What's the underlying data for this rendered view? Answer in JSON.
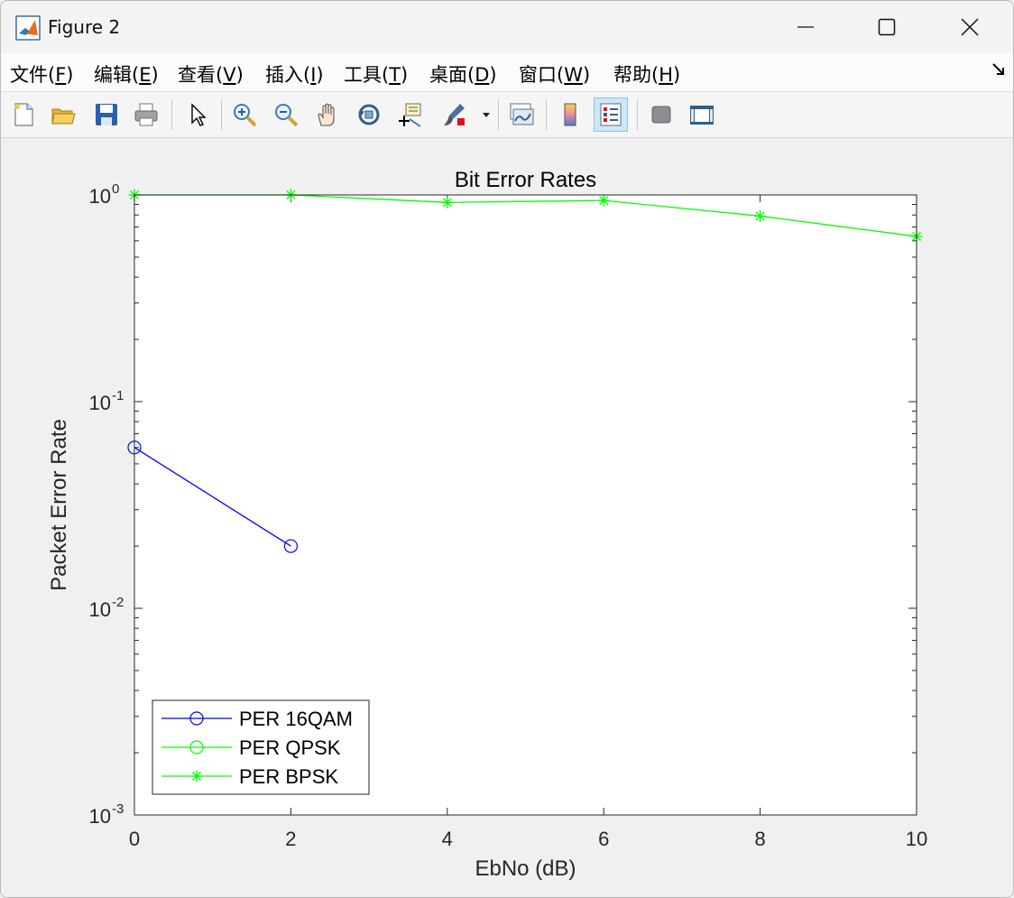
{
  "window": {
    "title": "Figure 2"
  },
  "menu": {
    "items": [
      {
        "label": "文件(",
        "key": "F",
        "tail": ")"
      },
      {
        "label": "编辑(",
        "key": "E",
        "tail": ")"
      },
      {
        "label": "查看(",
        "key": "V",
        "tail": ")"
      },
      {
        "label": "插入(",
        "key": "I",
        "tail": ")"
      },
      {
        "label": "工具(",
        "key": "T",
        "tail": ")"
      },
      {
        "label": "桌面(",
        "key": "D",
        "tail": ")"
      },
      {
        "label": "窗口(",
        "key": "W",
        "tail": ")"
      },
      {
        "label": "帮助(",
        "key": "H",
        "tail": ")"
      }
    ]
  },
  "toolbar": {
    "buttons": [
      "new-figure-icon",
      "open-file-icon",
      "save-icon",
      "print-icon",
      "select-arrow-icon",
      "zoom-in-icon",
      "zoom-out-icon",
      "pan-hand-icon",
      "rotate-3d-icon",
      "data-tip-icon",
      "brush-icon",
      "link-plot-icon",
      "colorbar-icon",
      "legend-icon",
      "hide-plot-tools-icon",
      "show-plot-tools-icon"
    ]
  },
  "chart_data": {
    "type": "line",
    "title": "Bit Error Rates",
    "xlabel": "EbNo (dB)",
    "ylabel": "Packet Error Rate",
    "yscale": "log",
    "xlim": [
      0,
      10
    ],
    "ylim": [
      0.001,
      1
    ],
    "xticks": [
      "0",
      "2",
      "4",
      "6",
      "8",
      "10"
    ],
    "yticks": [
      {
        "base": "10",
        "exp": "0"
      },
      {
        "base": "10",
        "exp": "-1"
      },
      {
        "base": "10",
        "exp": "-2"
      },
      {
        "base": "10",
        "exp": "-3"
      }
    ],
    "series": [
      {
        "name": "PER 16QAM",
        "color": "#0000ff",
        "marker": "circle",
        "x": [
          0,
          2
        ],
        "y": [
          0.06,
          0.02
        ]
      },
      {
        "name": "PER QPSK",
        "color": "#00ff00",
        "marker": "circle",
        "x": [],
        "y": []
      },
      {
        "name": "PER BPSK",
        "color": "#00ff00",
        "marker": "asterisk",
        "x": [
          0,
          2,
          4,
          6,
          8,
          10
        ],
        "y": [
          1.0,
          1.0,
          0.92,
          0.94,
          0.79,
          0.63
        ]
      }
    ],
    "legend_position": "bottom-left"
  }
}
